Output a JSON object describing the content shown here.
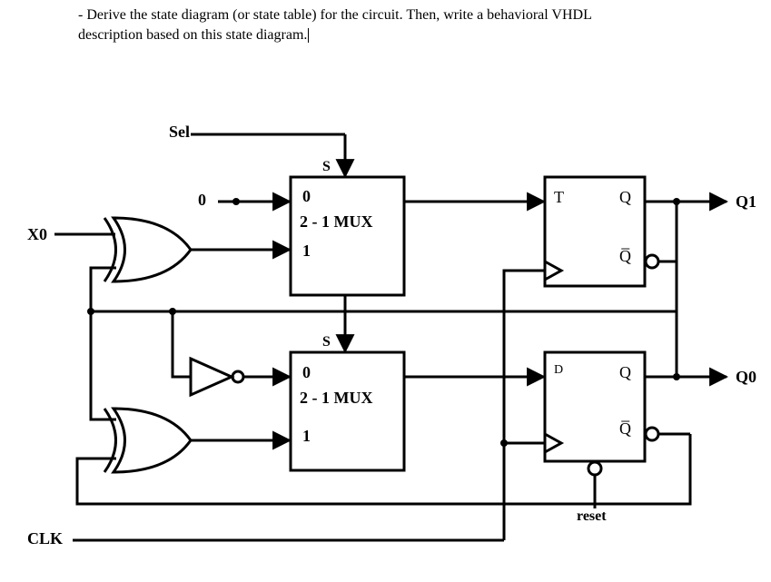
{
  "question": {
    "line1": "- Derive the state diagram (or state table) for the circuit. Then, write a behavioral VHDL",
    "line2": "description based on this state diagram."
  },
  "labels": {
    "sel": "Sel",
    "x0": "X0",
    "clk": "CLK",
    "reset": "reset",
    "q1": "Q1",
    "q0": "Q0",
    "zero": "0",
    "one": "1",
    "mux": "2 - 1 MUX",
    "s": "S",
    "t": "T",
    "d": "D",
    "q": "Q",
    "qbar": "Q̅"
  },
  "chart_data": {
    "type": "table",
    "title": "Sequential circuit schematic (two 2-to-1 multiplexers, one T flip-flop, one D flip-flop)",
    "components": [
      {
        "id": "XOR1",
        "type": "XOR2",
        "inputs": [
          "X0",
          "Q0"
        ],
        "output": "n_xor1"
      },
      {
        "id": "NOT1",
        "type": "NOT",
        "inputs": [
          "Q1"
        ],
        "output": "n_not1"
      },
      {
        "id": "XOR2",
        "type": "XOR2",
        "inputs": [
          "Q1",
          "Q0_bar"
        ],
        "output": "n_xor2"
      },
      {
        "id": "MUX1",
        "type": "MUX2to1",
        "select": "Sel",
        "in0": "0",
        "in1": "n_xor1",
        "output": "T_in"
      },
      {
        "id": "MUX2",
        "type": "MUX2to1",
        "select": "Sel",
        "in0": "n_not1",
        "in1": "n_xor2",
        "output": "D_in"
      },
      {
        "id": "TFF",
        "type": "T_FF",
        "T": "T_in",
        "clk": "CLK",
        "Q": "Q1",
        "Qbar": "Q1_bar"
      },
      {
        "id": "DFF",
        "type": "D_FF",
        "D": "D_in",
        "clk": "CLK",
        "reset": "reset",
        "Q": "Q0",
        "Qbar": "Q0_bar"
      }
    ],
    "inputs": [
      "X0",
      "Sel",
      "CLK",
      "reset"
    ],
    "outputs": [
      "Q1",
      "Q0"
    ]
  }
}
